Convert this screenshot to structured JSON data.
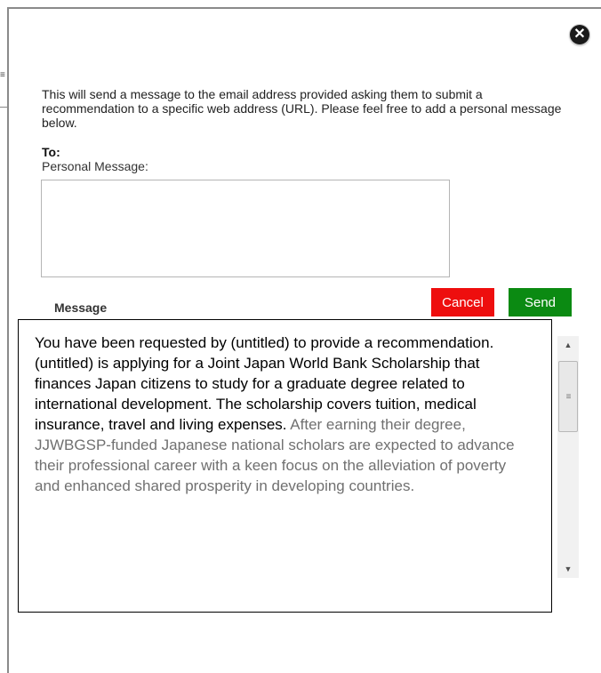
{
  "dialog": {
    "close_glyph": "✕",
    "intro_text": "This will send a message to the email address provided asking them to submit a recommendation to a specific web address (URL). Please feel free to add a personal message below.",
    "to_label": "To:",
    "personal_message_label": "Personal Message:",
    "personal_message_value": "",
    "cancel_label": "Cancel",
    "send_label": "Send",
    "message_heading": "Message",
    "message_body_main": "You have been requested by (untitled) to provide a recommendation. (untitled) is applying for a Joint Japan World Bank Scholarship that finances Japan citizens to study for a graduate degree related to international development.  The scholarship covers tuition, medical insurance, travel and living expenses. ",
    "message_body_grey": " After earning their degree, JJWBGSP-funded Japanese national scholars are expected to advance their professional career with a keen focus on the alleviation of poverty and enhanced shared prosperity in developing countries."
  },
  "scrollbar": {
    "up_glyph": "▲",
    "down_glyph": "▼",
    "grip_glyph": "≡"
  },
  "background": {
    "edge_glyph": "≡"
  },
  "colors": {
    "cancel": "#ee0e0e",
    "send": "#0b8a12",
    "grey_text": "#707070"
  }
}
